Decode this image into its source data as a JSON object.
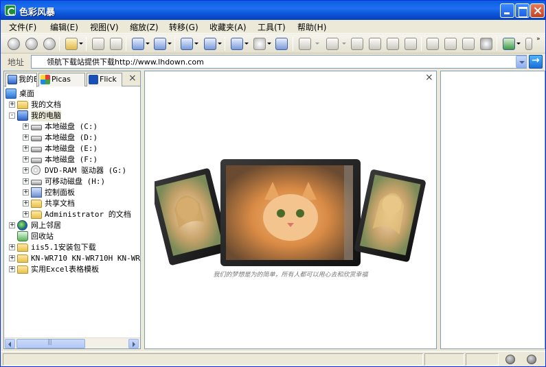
{
  "window": {
    "title": "色彩风暴"
  },
  "menu": [
    "文件(F)",
    "编辑(E)",
    "视图(V)",
    "缩放(Z)",
    "转移(G)",
    "收藏夹(A)",
    "工具(T)",
    "帮助(H)"
  ],
  "toolbar": {
    "icons": [
      "back-icon",
      "forward-icon",
      "up-icon",
      "favorites-icon",
      "save-icon",
      "print-icon",
      "view-mode-icon",
      "thumbnail-icon",
      "copy-icon",
      "move-icon",
      "rotate-icon",
      "effect-icon",
      "slideshow-icon",
      "zoom-out-icon",
      "zoom-in-icon",
      "fit-icon",
      "actual-size-icon",
      "width-icon",
      "height-icon",
      "prev-icon",
      "next-icon",
      "fullscreen-icon",
      "settings-icon",
      "browser-icon",
      "help-icon"
    ]
  },
  "address": {
    "label": "地址",
    "value": "领航下载站提供下载http://www.lhdown.com"
  },
  "left_panel": {
    "tabs": [
      {
        "label": "我的E",
        "icon": "computer-icon"
      },
      {
        "label": "Picas",
        "icon": "picasa-icon"
      },
      {
        "label": "Flick",
        "icon": "flickr-icon"
      }
    ],
    "close_label": "×",
    "tree": [
      {
        "label": "桌面",
        "icon": "desktop-icon",
        "level": 0,
        "expander": ""
      },
      {
        "label": "我的文档",
        "icon": "folder-icon",
        "level": 1,
        "expander": "+"
      },
      {
        "label": "我的电脑",
        "icon": "computer-icon",
        "level": 1,
        "expander": "-"
      },
      {
        "label": "本地磁盘 (C:)",
        "icon": "drive-icon",
        "level": 2,
        "expander": "+"
      },
      {
        "label": "本地磁盘 (D:)",
        "icon": "drive-icon",
        "level": 2,
        "expander": "+"
      },
      {
        "label": "本地磁盘 (E:)",
        "icon": "drive-icon",
        "level": 2,
        "expander": "+"
      },
      {
        "label": "本地磁盘 (F:)",
        "icon": "drive-icon",
        "level": 2,
        "expander": "+"
      },
      {
        "label": "DVD-RAM 驱动器 (G:)",
        "icon": "cd-drive-icon",
        "level": 2,
        "expander": "+"
      },
      {
        "label": "可移动磁盘 (H:)",
        "icon": "drive-icon",
        "level": 2,
        "expander": "+"
      },
      {
        "label": "控制面板",
        "icon": "control-panel-icon",
        "level": 2,
        "expander": "+"
      },
      {
        "label": "共享文档",
        "icon": "folder-icon",
        "level": 2,
        "expander": "+"
      },
      {
        "label": "Administrator 的文档",
        "icon": "folder-icon",
        "level": 2,
        "expander": "+"
      },
      {
        "label": "网上邻居",
        "icon": "network-icon",
        "level": 1,
        "expander": "+"
      },
      {
        "label": "回收站",
        "icon": "recycle-bin-icon",
        "level": 1,
        "expander": ""
      },
      {
        "label": "iis5.1安装包下载",
        "icon": "folder-icon",
        "level": 1,
        "expander": "+"
      },
      {
        "label": "KN-WR710 KN-WR710H KN-WR71",
        "icon": "folder-icon",
        "level": 1,
        "expander": "+"
      },
      {
        "label": "实用Excel表格模板",
        "icon": "folder-icon",
        "level": 1,
        "expander": "+"
      }
    ]
  },
  "center_panel": {
    "close_label": "×",
    "caption": "我们的梦想是为的简单，所有人都可以用心去和欣赏幸福"
  },
  "colors": {
    "titlebar": "#0a5fe0",
    "chrome": "#ece9d8",
    "border": "#7f9db9"
  }
}
